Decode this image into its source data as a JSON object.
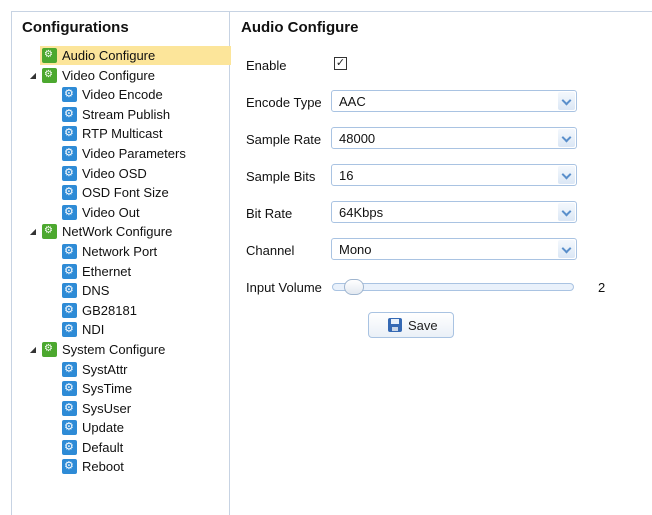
{
  "sidebar": {
    "title": "Configurations",
    "items": [
      {
        "label": "Audio Configure",
        "level": 1,
        "kind": "folder",
        "expander": "",
        "selected": true
      },
      {
        "label": "Video Configure",
        "level": 1,
        "kind": "folder",
        "expander": "◢",
        "selected": false
      },
      {
        "label": "Video Encode",
        "level": 2,
        "kind": "leaf",
        "expander": "",
        "selected": false
      },
      {
        "label": "Stream Publish",
        "level": 2,
        "kind": "leaf",
        "expander": "",
        "selected": false
      },
      {
        "label": "RTP Multicast",
        "level": 2,
        "kind": "leaf",
        "expander": "",
        "selected": false
      },
      {
        "label": "Video Parameters",
        "level": 2,
        "kind": "leaf",
        "expander": "",
        "selected": false
      },
      {
        "label": "Video OSD",
        "level": 2,
        "kind": "leaf",
        "expander": "",
        "selected": false
      },
      {
        "label": "OSD Font Size",
        "level": 2,
        "kind": "leaf",
        "expander": "",
        "selected": false
      },
      {
        "label": "Video Out",
        "level": 2,
        "kind": "leaf",
        "expander": "",
        "selected": false
      },
      {
        "label": "NetWork Configure",
        "level": 1,
        "kind": "folder",
        "expander": "◢",
        "selected": false
      },
      {
        "label": "Network Port",
        "level": 2,
        "kind": "leaf",
        "expander": "",
        "selected": false
      },
      {
        "label": "Ethernet",
        "level": 2,
        "kind": "leaf",
        "expander": "",
        "selected": false
      },
      {
        "label": "DNS",
        "level": 2,
        "kind": "leaf",
        "expander": "",
        "selected": false
      },
      {
        "label": "GB28181",
        "level": 2,
        "kind": "leaf",
        "expander": "",
        "selected": false
      },
      {
        "label": "NDI",
        "level": 2,
        "kind": "leaf",
        "expander": "",
        "selected": false
      },
      {
        "label": "System Configure",
        "level": 1,
        "kind": "folder",
        "expander": "◢",
        "selected": false
      },
      {
        "label": "SystAttr",
        "level": 2,
        "kind": "leaf",
        "expander": "",
        "selected": false
      },
      {
        "label": "SysTime",
        "level": 2,
        "kind": "leaf",
        "expander": "",
        "selected": false
      },
      {
        "label": "SysUser",
        "level": 2,
        "kind": "leaf",
        "expander": "",
        "selected": false
      },
      {
        "label": "Update",
        "level": 2,
        "kind": "leaf",
        "expander": "",
        "selected": false
      },
      {
        "label": "Default",
        "level": 2,
        "kind": "leaf",
        "expander": "",
        "selected": false
      },
      {
        "label": "Reboot",
        "level": 2,
        "kind": "leaf",
        "expander": "",
        "selected": false
      }
    ]
  },
  "main": {
    "title": "Audio Configure",
    "enable": {
      "label": "Enable",
      "checked": true,
      "check_glyph": "✓"
    },
    "encode_type": {
      "label": "Encode Type",
      "value": "AAC"
    },
    "sample_rate": {
      "label": "Sample Rate",
      "value": "48000"
    },
    "sample_bits": {
      "label": "Sample Bits",
      "value": "16"
    },
    "bit_rate": {
      "label": "Bit Rate",
      "value": "64Kbps"
    },
    "channel": {
      "label": "Channel",
      "value": "Mono"
    },
    "input_volume": {
      "label": "Input Volume",
      "value": "2",
      "fraction": 0.02
    },
    "save_label": "Save"
  },
  "colors": {
    "selected_bg": "#fce59a",
    "folder_icon": "#4ca82f",
    "leaf_icon": "#2e8bd6",
    "border": "#a9c3e2"
  },
  "icons": {
    "folder": "gear-folder-icon",
    "leaf": "gear-icon",
    "save": "floppy-disk-icon",
    "dropdown": "chevron-down-icon",
    "expander": "expand-triangle-icon"
  }
}
